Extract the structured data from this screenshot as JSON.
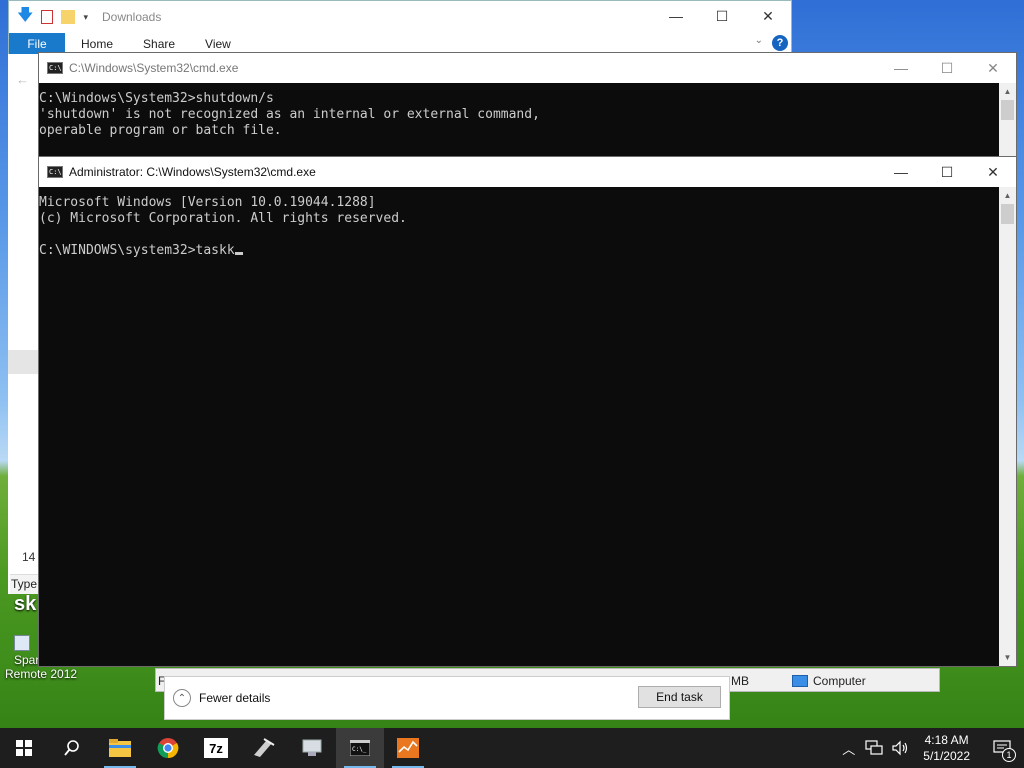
{
  "explorer": {
    "title": "Downloads",
    "tabs": {
      "file": "File",
      "home": "Home",
      "share": "Share",
      "view": "View"
    },
    "help": "?",
    "status_count": "14",
    "type_label": "Type:"
  },
  "desktop": {
    "shortcut_label_1": "Spar",
    "shortcut_label_2": "Remote 2012",
    "sky_label": "sk"
  },
  "cmd_back": {
    "title": "C:\\Windows\\System32\\cmd.exe",
    "lines": [
      "C:\\Windows\\System32>shutdown/s",
      "'shutdown' is not recognized as an internal or external command,",
      "operable program or batch file."
    ]
  },
  "cmd_front": {
    "title": "Administrator: C:\\Windows\\System32\\cmd.exe",
    "lines": [
      "Microsoft Windows [Version 10.0.19044.1288]",
      "(c) Microsoft Corporation. All rights reserved.",
      "",
      "C:\\WINDOWS\\system32>taskk"
    ]
  },
  "taskmgr": {
    "fewer_details": "Fewer details",
    "end_task": "End task",
    "col_partial_left": "F",
    "col_partial_mb": "MB",
    "computer_label": "Computer"
  },
  "taskbar": {
    "time": "4:18 AM",
    "date": "5/1/2022",
    "notification_count": "1",
    "sevenzip_label": "7z"
  }
}
